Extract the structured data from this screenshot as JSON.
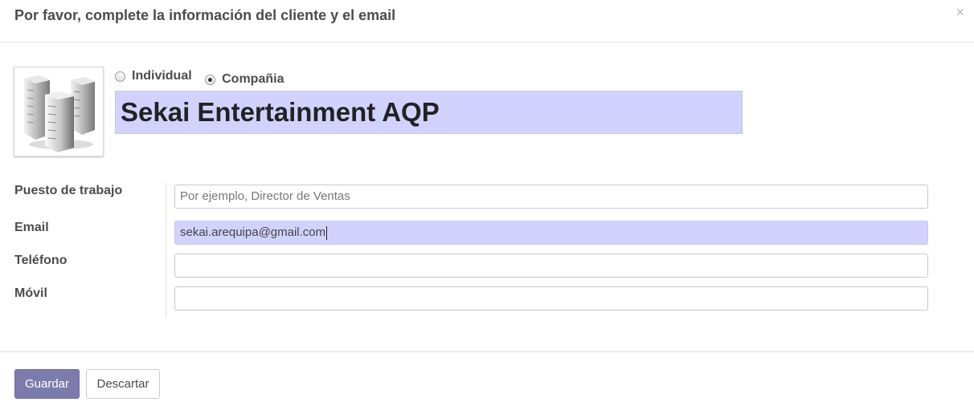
{
  "dialog": {
    "title": "Por favor, complete la información del cliente y el email",
    "close_symbol": "×"
  },
  "company_type": {
    "options": [
      "Individual",
      "Compañia"
    ],
    "selected": "Compañia"
  },
  "partner": {
    "name": "Sekai Entertainment AQP",
    "avatar_icon": "company-buildings-icon"
  },
  "fields": {
    "job_position": {
      "label": "Puesto de trabajo",
      "value": "",
      "placeholder": "Por ejemplo, Director de Ventas"
    },
    "email": {
      "label": "Email",
      "value": "sekai.arequipa@gmail.com"
    },
    "phone": {
      "label": "Teléfono",
      "value": ""
    },
    "mobile": {
      "label": "Móvil",
      "value": ""
    }
  },
  "footer": {
    "save_label": "Guardar",
    "discard_label": "Descartar"
  },
  "colors": {
    "primary": "#7c7bad",
    "focused_field": "#d2d2ff"
  }
}
